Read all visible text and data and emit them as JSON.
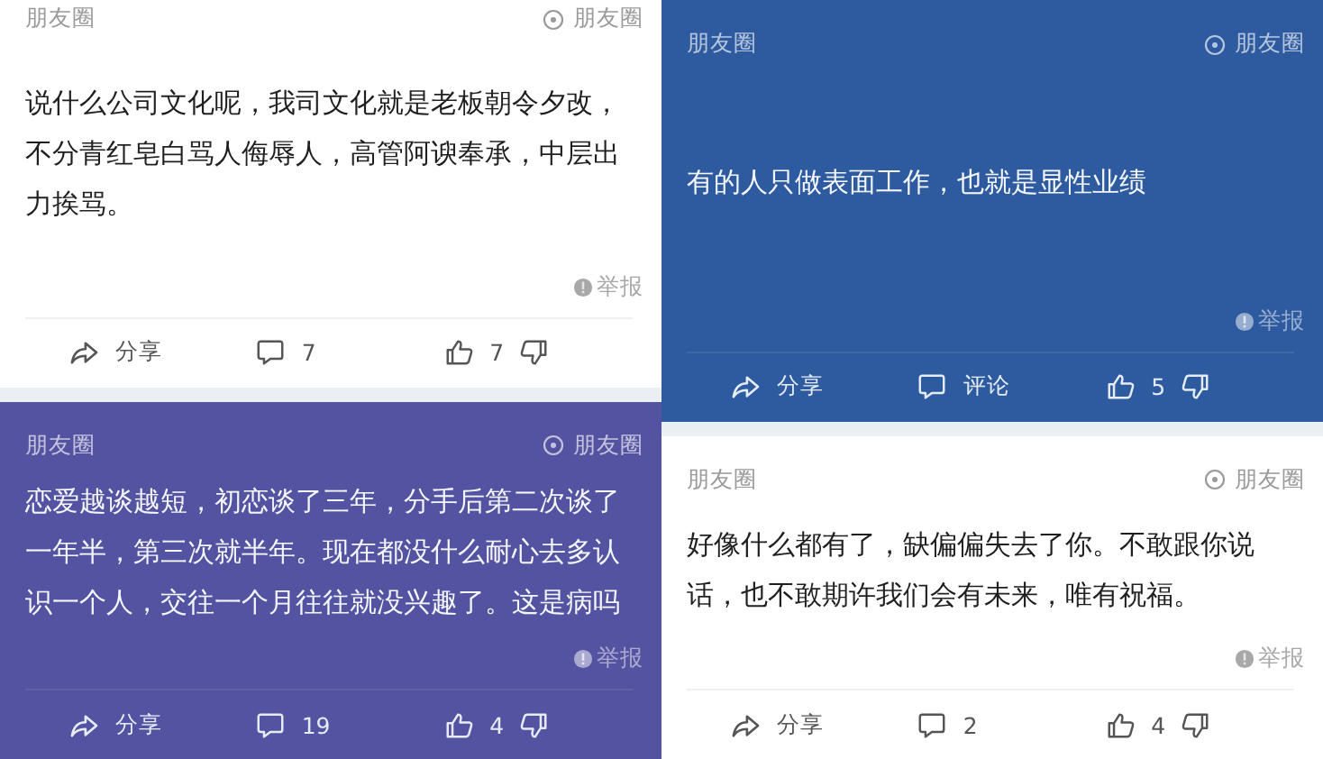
{
  "columns": [
    {
      "cards": [
        {
          "color": "#ffffff",
          "source": "朋友圈",
          "channel": "朋友圈",
          "text": "说什么公司文化呢，我司文化就是老板朝令夕改，不分青红皂白骂人侮辱人，高管阿谀奉承，中层出力挨骂。",
          "report": "举报",
          "share": "分享",
          "comments": "7",
          "likes": "7"
        },
        {
          "color": "#5453a1",
          "source": "朋友圈",
          "channel": "朋友圈",
          "text": "恋爱越谈越短，初恋谈了三年，分手后第二次谈了一年半，第三次就半年。现在都没什么耐心去多认识一个人，交往一个月往往就没兴趣了。这是病吗",
          "report": "举报",
          "share": "分享",
          "comments": "19",
          "likes": "4"
        }
      ]
    },
    {
      "cards": [
        {
          "color": "#2e5b9f",
          "source": "朋友圈",
          "channel": "朋友圈",
          "text": "有的人只做表面工作，也就是显性业绩",
          "report": "举报",
          "share": "分享",
          "comments": "评论",
          "likes": "5"
        },
        {
          "color": "#ffffff",
          "source": "朋友圈",
          "channel": "朋友圈",
          "text": "好像什么都有了，缺偏偏失去了你。不敢跟你说话，也不敢期许我们会有未来，唯有祝福。",
          "report": "举报",
          "share": "分享",
          "comments": "2",
          "likes": "4"
        }
      ]
    }
  ]
}
